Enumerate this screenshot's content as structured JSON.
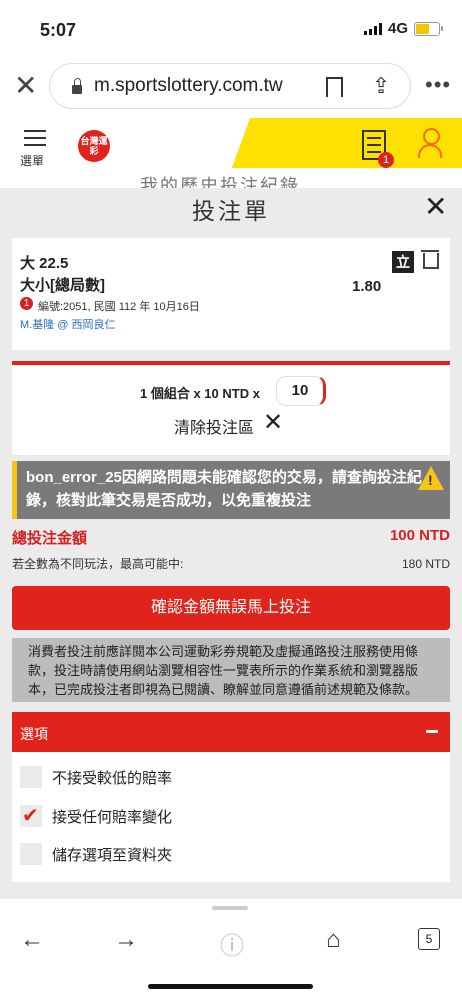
{
  "status": {
    "time": "5:07",
    "network": "4G"
  },
  "browser": {
    "url": "m.sportslottery.com.tw",
    "tab_count": "5"
  },
  "site": {
    "menu_label": "選單",
    "logo_text": "台灣運彩",
    "cart_count": "1",
    "underlying_title": "我的歷史投注紀錄"
  },
  "betslip": {
    "title": "投注單",
    "bet": {
      "selection": "大 22.5",
      "market": "大小[總局數]",
      "odds": "1.80",
      "live_badge": "立",
      "info_count": "1",
      "meta": "編號:2051, 民國 112 年 10月16日",
      "teams": "M.基隆 @ 西岡良仁"
    },
    "combo": {
      "text": "1 個組合 x 10 NTD x",
      "stake": "10",
      "clear_label": "清除投注區"
    },
    "error": {
      "message": "bon_error_25因網路問題未能確認您的交易，請查詢投注紀錄，核對此筆交易是否成功，以免重複投注"
    },
    "total": {
      "label": "總投注金額",
      "value": "100 NTD"
    },
    "max_win": {
      "label": "若全數為不同玩法，最高可能中:",
      "value": "180 NTD"
    },
    "confirm_label": "確認金額無誤馬上投注",
    "terms": "消費者投注前應詳閱本公司運動彩券規範及虛擬通路投注服務使用條款，投注時請使用網站瀏覽相容性一覽表所示的作業系統和瀏覽器版本，已完成投注者即視為已閱讀、瞭解並同意遵循前述規範及條款。",
    "options": {
      "header": "選項",
      "items": [
        {
          "label": "不接受較低的賠率",
          "checked": false
        },
        {
          "label": "接受任何賠率變化",
          "checked": true
        },
        {
          "label": "儲存選項至資料夾",
          "checked": false
        }
      ]
    }
  },
  "colors": {
    "brand_red": "#e0241b",
    "header_yellow": "#ffe100",
    "warning_yellow": "#f5c518"
  }
}
